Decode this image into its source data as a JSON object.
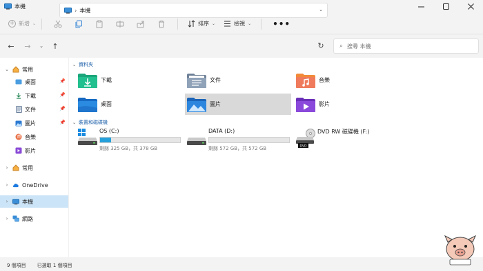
{
  "window": {
    "title": "本機"
  },
  "toolbar": {
    "new_label": "新增",
    "sort_label": "排序",
    "view_label": "檢視",
    "more_label": "•••"
  },
  "address": {
    "path_label": "本機",
    "search_placeholder": "搜尋 本機"
  },
  "sidebar": {
    "quick_access": "常用",
    "pinned": [
      {
        "label": "桌面",
        "icon": "desktop-icon"
      },
      {
        "label": "下載",
        "icon": "download-icon"
      },
      {
        "label": "文件",
        "icon": "document-icon"
      },
      {
        "label": "圖片",
        "icon": "pictures-icon"
      },
      {
        "label": "音樂",
        "icon": "music-icon"
      },
      {
        "label": "影片",
        "icon": "videos-icon"
      }
    ],
    "favorites": "常用",
    "onedrive": "OneDrive",
    "thispc": "本機",
    "network": "網路"
  },
  "sections": {
    "folders_title": "資料夾",
    "drives_title": "裝置和磁碟機"
  },
  "folders": [
    {
      "label": "下載",
      "icon": "download-folder-icon"
    },
    {
      "label": "文件",
      "icon": "document-folder-icon"
    },
    {
      "label": "音樂",
      "icon": "music-folder-icon"
    },
    {
      "label": "桌面",
      "icon": "desktop-folder-icon"
    },
    {
      "label": "圖片",
      "icon": "pictures-folder-icon"
    },
    {
      "label": "影片",
      "icon": "videos-folder-icon"
    }
  ],
  "drives": [
    {
      "name": "OS (C:)",
      "space": "剩餘 325 GB，共 378 GB",
      "used_fraction": 0.14
    },
    {
      "name": "DATA (D:)",
      "space": "剩餘 572 GB，共 572 GB",
      "used_fraction": 0.0
    },
    {
      "name": "DVD RW 磁碟機 (F:)"
    }
  ],
  "status": {
    "item_count": "9 個項目",
    "selected": "已選取 1 個項目"
  },
  "colors": {
    "accent": "#0078d4",
    "selection": "#cce4f7",
    "drive_fill": "#26a0da"
  }
}
